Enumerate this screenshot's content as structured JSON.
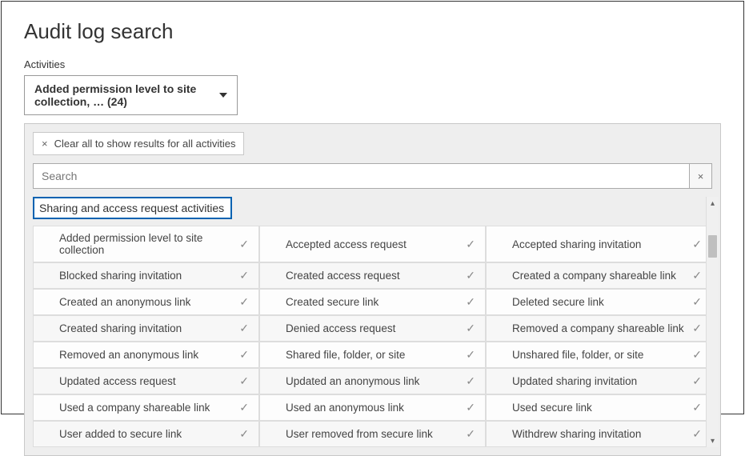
{
  "page": {
    "title": "Audit log search"
  },
  "activities": {
    "label": "Activities",
    "selected_text": "Added permission level to site collection, … (24)"
  },
  "panel": {
    "clear_all_label": "Clear all to show results for all activities",
    "search_placeholder": "Search",
    "category_header": "Sharing and access request activities",
    "items": [
      {
        "col1": "Added permission level to site collection",
        "col2": "Accepted access request",
        "col3": "Accepted sharing invitation"
      },
      {
        "col1": "Blocked sharing invitation",
        "col2": "Created access request",
        "col3": "Created a company shareable link"
      },
      {
        "col1": "Created an anonymous link",
        "col2": "Created secure link",
        "col3": "Deleted secure link"
      },
      {
        "col1": "Created sharing invitation",
        "col2": "Denied access request",
        "col3": "Removed a company shareable link"
      },
      {
        "col1": "Removed an anonymous link",
        "col2": "Shared file, folder, or site",
        "col3": "Unshared file, folder, or site"
      },
      {
        "col1": "Updated access request",
        "col2": "Updated an anonymous link",
        "col3": "Updated sharing invitation"
      },
      {
        "col1": "Used a company shareable link",
        "col2": "Used an anonymous link",
        "col3": "Used secure link"
      },
      {
        "col1": "User added to secure link",
        "col2": "User removed from secure link",
        "col3": "Withdrew sharing invitation"
      }
    ],
    "check_glyph": "✓",
    "close_glyph": "×"
  }
}
